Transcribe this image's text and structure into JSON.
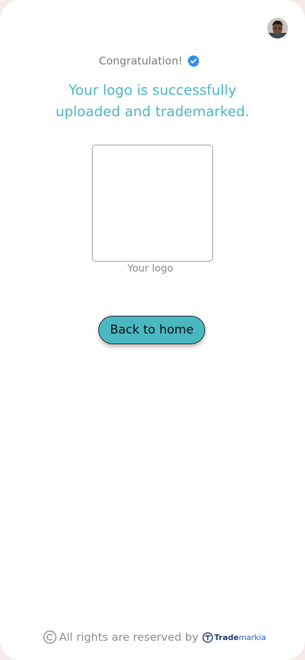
{
  "header": {
    "congrats_text": "Congratulation!",
    "avatar_icon": "user-avatar"
  },
  "main": {
    "headline": "Your logo is successfully uploaded and trademarked.",
    "logo_caption": "Your logo",
    "back_button_label": "Back to home"
  },
  "footer": {
    "rights_text": "All rights are reserved by",
    "brand_part1": "Trade",
    "brand_part2": "markia"
  },
  "colors": {
    "accent": "#4ab8c1",
    "verified": "#2f8fe6",
    "brand_dark": "#1f3b7a",
    "brand_blue": "#1f5fd0"
  }
}
